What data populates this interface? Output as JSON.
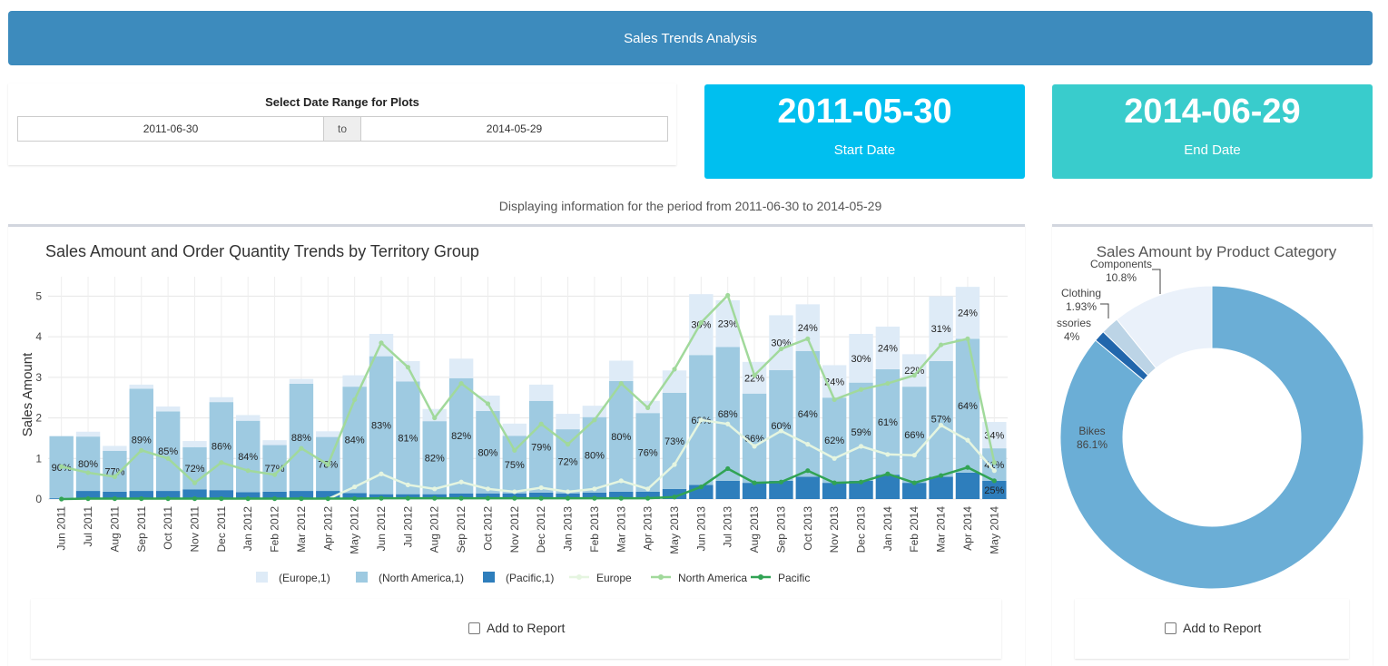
{
  "header": {
    "title": "Sales Trends Analysis"
  },
  "date_range": {
    "label": "Select Date Range for Plots",
    "start": "2011-06-30",
    "separator": "to",
    "end": "2014-05-29"
  },
  "start_box": {
    "value": "2011-05-30",
    "label": "Start Date",
    "color": "#00bfef"
  },
  "end_box": {
    "value": "2014-06-29",
    "label": "End Date",
    "color": "#39cccc"
  },
  "period_text": "Displaying information for the period from 2011-06-30 to 2014-05-29",
  "report": {
    "label": "Add to Report",
    "label2": "Add to Report"
  },
  "chart_data": [
    {
      "type": "bar",
      "title": "Sales Amount and Order Quantity Trends by Territory Group",
      "xlabel": "",
      "ylabel": "Sales Amount",
      "ylim": [
        0,
        5.3
      ],
      "yticks": [
        0,
        1,
        2,
        3,
        4,
        5
      ],
      "stacked": true,
      "grid": true,
      "legend_position": "bottom",
      "categories": [
        "Jun 2011",
        "Jul 2011",
        "Aug 2011",
        "Sep 2011",
        "Oct 2011",
        "Nov 2011",
        "Dec 2011",
        "Jan 2012",
        "Feb 2012",
        "Mar 2012",
        "Apr 2012",
        "May 2012",
        "Jun 2012",
        "Jul 2012",
        "Aug 2012",
        "Sep 2012",
        "Oct 2012",
        "Nov 2012",
        "Dec 2012",
        "Jan 2013",
        "Feb 2013",
        "Mar 2013",
        "Apr 2013",
        "May 2013",
        "Jun 2013",
        "Jul 2013",
        "Aug 2013",
        "Sep 2013",
        "Oct 2013",
        "Nov 2013",
        "Dec 2013",
        "Jan 2014",
        "Feb 2014",
        "Mar 2014",
        "Apr 2014",
        "May 2014"
      ],
      "bar_series": [
        {
          "name": "(Pacific,1)",
          "color": "#2e7ebc",
          "values": [
            0.02,
            0.2,
            0.18,
            0.2,
            0.2,
            0.24,
            0.22,
            0.17,
            0.18,
            0.2,
            0.2,
            0.15,
            0.12,
            0.12,
            0.12,
            0.14,
            0.14,
            0.14,
            0.16,
            0.14,
            0.16,
            0.18,
            0.18,
            0.25,
            0.35,
            0.45,
            0.4,
            0.45,
            0.55,
            0.4,
            0.45,
            0.6,
            0.4,
            0.55,
            0.65,
            0.45
          ],
          "labels": [
            "",
            "",
            "",
            "",
            "",
            "",
            "",
            "",
            "",
            "",
            "",
            "",
            "",
            "",
            "",
            "",
            "",
            "",
            "",
            "",
            "",
            "",
            "",
            "",
            "",
            "",
            "",
            "",
            "",
            "",
            "",
            "",
            "",
            "",
            "",
            "25%"
          ]
        },
        {
          "name": "(North America,1)",
          "color": "#9ecae1",
          "values": [
            1.53,
            1.34,
            1.01,
            2.52,
            1.96,
            1.04,
            2.17,
            1.76,
            1.15,
            2.64,
            1.33,
            2.62,
            3.4,
            2.78,
            1.8,
            2.84,
            2.03,
            1.42,
            2.26,
            1.58,
            1.86,
            2.73,
            1.94,
            2.37,
            3.2,
            3.3,
            2.2,
            2.73,
            3.1,
            2.1,
            2.42,
            2.6,
            2.37,
            2.85,
            3.3,
            0.8
          ],
          "labels": [
            "90%",
            "80%",
            "77%",
            "89%",
            "85%",
            "72%",
            "86%",
            "84%",
            "77%",
            "88%",
            "78%",
            "84%",
            "83%",
            "81%",
            "82%",
            "82%",
            "80%",
            "75%",
            "79%",
            "72%",
            "80%",
            "80%",
            "76%",
            "73%",
            "63%",
            "68%",
            "66%",
            "60%",
            "64%",
            "62%",
            "59%",
            "61%",
            "66%",
            "57%",
            "64%",
            "41%"
          ]
        },
        {
          "name": "(Europe,1)",
          "color": "#deebf7",
          "values": [
            0,
            0.12,
            0.12,
            0.1,
            0.12,
            0.15,
            0.12,
            0.14,
            0.12,
            0.12,
            0.14,
            0.28,
            0.55,
            0.5,
            0.3,
            0.48,
            0.38,
            0.3,
            0.4,
            0.38,
            0.28,
            0.5,
            0.3,
            0.55,
            1.5,
            1.15,
            0.78,
            1.35,
            1.15,
            0.8,
            1.2,
            1.05,
            0.8,
            1.6,
            1.28,
            0.65
          ],
          "labels": [
            "",
            "",
            "",
            "",
            "",
            "",
            "",
            "",
            "",
            "",
            "",
            "",
            "",
            "",
            "",
            "",
            "",
            "",
            "",
            "",
            "",
            "",
            "",
            "",
            "30%",
            "23%",
            "22%",
            "30%",
            "24%",
            "24%",
            "30%",
            "24%",
            "22%",
            "31%",
            "24%",
            "34%"
          ]
        }
      ],
      "line_series": [
        {
          "name": "Europe",
          "color": "#e5f5e0",
          "values": [
            0,
            0,
            0,
            0,
            0,
            0,
            0,
            0,
            0,
            0,
            0,
            0.3,
            0.62,
            0.35,
            0.25,
            0.42,
            0.25,
            0.18,
            0.28,
            0.18,
            0.25,
            0.45,
            0.25,
            0.85,
            1.95,
            1.85,
            1.3,
            1.68,
            1.35,
            1.0,
            1.3,
            1.1,
            1.08,
            1.82,
            1.45,
            0.7
          ]
        },
        {
          "name": "North America",
          "color": "#a1d99b",
          "values": [
            0.8,
            0.65,
            0.55,
            1.2,
            1.0,
            0.4,
            0.9,
            0.7,
            0.6,
            1.25,
            0.85,
            2.45,
            3.85,
            3.25,
            2.0,
            2.85,
            2.35,
            1.2,
            1.85,
            1.35,
            1.95,
            2.85,
            2.25,
            3.2,
            4.35,
            5.02,
            3.05,
            3.7,
            3.95,
            2.45,
            2.7,
            2.85,
            3.05,
            3.8,
            3.95,
            0.9
          ]
        },
        {
          "name": "Pacific",
          "color": "#31a354",
          "values": [
            0,
            0.01,
            0.01,
            0.01,
            0.01,
            0.01,
            0.01,
            0.01,
            0.01,
            0.01,
            0.01,
            0.01,
            0.02,
            0.02,
            0.02,
            0.02,
            0.02,
            0.02,
            0.02,
            0.02,
            0.02,
            0.02,
            0.02,
            0.05,
            0.3,
            0.75,
            0.4,
            0.42,
            0.7,
            0.4,
            0.42,
            0.62,
            0.4,
            0.58,
            0.78,
            0.45
          ]
        }
      ]
    },
    {
      "type": "pie",
      "title": "Sales Amount by Product Category",
      "hole": true,
      "slices": [
        {
          "label": "Bikes",
          "percent": "86.1%",
          "value": 86.1,
          "color": "#6baed6"
        },
        {
          "label": "Accessories",
          "percent": "1.2%",
          "value": 1.2,
          "color": "#2166ac"
        },
        {
          "label": "Clothing",
          "percent": "1.93%",
          "value": 1.93,
          "color": "#bcd4e6"
        },
        {
          "label": "Components",
          "percent": "10.8%",
          "value": 10.8,
          "color": "#eaf1fa"
        }
      ],
      "visible_labels": {
        "bikes": "Bikes",
        "bikes_pct": "86.1%",
        "clothing": "Clothing",
        "clothing_pct": "1.93%",
        "components": "Components",
        "components_pct": "10.8%",
        "accessories": "ssories",
        "accessories_pct": "4%"
      }
    }
  ]
}
